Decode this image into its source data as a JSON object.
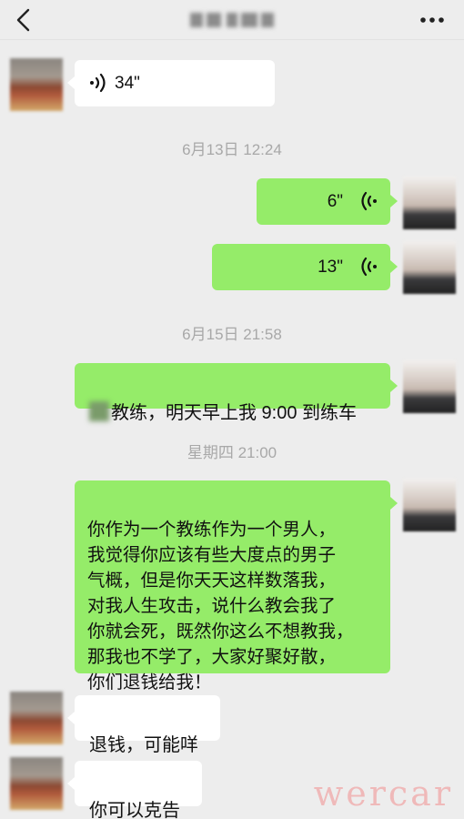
{
  "header": {
    "back_icon": "chevron-left-icon",
    "more_icon": "ellipsis-icon"
  },
  "messages": [
    {
      "from": "other",
      "kind": "voice",
      "duration": "34\""
    },
    {
      "kind": "timestamp",
      "text": "6月13日 12:24"
    },
    {
      "from": "self",
      "kind": "voice",
      "duration": "6\""
    },
    {
      "from": "self",
      "kind": "voice",
      "duration": "13\""
    },
    {
      "kind": "timestamp",
      "text": "6月15日 21:58"
    },
    {
      "from": "self",
      "kind": "text",
      "text": "教练，明天早上我 9:00 到练车"
    },
    {
      "kind": "timestamp",
      "text": "星期四 21:00"
    },
    {
      "from": "self",
      "kind": "text",
      "text": "你作为一个教练作为一个男人，\n我觉得你应该有些大度点的男子\n气概，但是你天天这样数落我，\n对我人生攻击，说什么教会我了\n你就会死，既然你这么不想教我，\n那我也不学了，大家好聚好散，\n你们退钱给我！"
    },
    {
      "from": "other",
      "kind": "text",
      "text": "退钱，可能咩"
    },
    {
      "from": "other",
      "kind": "text",
      "text": "你可以克告"
    }
  ],
  "watermark": "wercar",
  "colors": {
    "background": "#ededed",
    "self_bubble": "#95ec69",
    "other_bubble": "#ffffff",
    "timestamp": "#a8a8a8"
  }
}
